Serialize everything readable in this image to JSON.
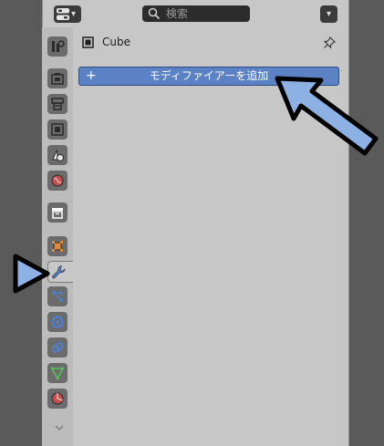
{
  "header": {
    "search_placeholder": "検索",
    "editor_type_icon": "properties-editor-icon",
    "options_icon": "chevron-down-icon"
  },
  "tabs": [
    {
      "name": "tool",
      "icon": "tool-icon",
      "color": "#3a3a3a"
    },
    {
      "name": "render",
      "icon": "render-icon",
      "color": "#3a3a3a"
    },
    {
      "name": "output",
      "icon": "output-icon",
      "color": "#3a3a3a"
    },
    {
      "name": "view-layer",
      "icon": "view-layer-icon",
      "color": "#3a3a3a"
    },
    {
      "name": "scene",
      "icon": "scene-icon",
      "color": "#3a3a3a"
    },
    {
      "name": "world",
      "icon": "world-icon",
      "color": "#c0504d"
    },
    {
      "name": "collection",
      "icon": "collection-icon",
      "color": "#ffffff"
    },
    {
      "name": "object",
      "icon": "object-icon",
      "color": "#e08a3c"
    },
    {
      "name": "modifier",
      "icon": "wrench-icon",
      "color": "#4f7fc8"
    },
    {
      "name": "particles",
      "icon": "particles-icon",
      "color": "#4f7fc8"
    },
    {
      "name": "physics",
      "icon": "physics-icon",
      "color": "#4f7fc8"
    },
    {
      "name": "constraints",
      "icon": "constraints-icon",
      "color": "#4f7fc8"
    },
    {
      "name": "data",
      "icon": "mesh-data-icon",
      "color": "#58b85a"
    },
    {
      "name": "material",
      "icon": "material-icon",
      "color": "#c0504d"
    }
  ],
  "object": {
    "name": "Cube",
    "icon": "mesh-object-icon"
  },
  "modifier_panel": {
    "add_label": "モディファイアーを追加",
    "plus": "+",
    "accent_color": "#5a82c4"
  },
  "annotations": {
    "arrow_color": "#8eb1e3",
    "outline_color": "#000000"
  }
}
